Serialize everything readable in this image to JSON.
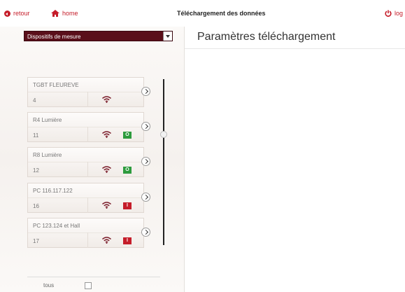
{
  "header": {
    "back_label": "retour",
    "home_label": "home",
    "title": "Téléchargement des données",
    "logout_label": "log"
  },
  "sidebar": {
    "dropdown_value": "Dispositifs de mesure",
    "devices": [
      {
        "name": "TGBT FLEUREVE",
        "number": "4",
        "badge": "",
        "badge_color": ""
      },
      {
        "name": "R4 Lumière",
        "number": "11",
        "badge": "O",
        "badge_color": "green"
      },
      {
        "name": "R8 Lumière",
        "number": "12",
        "badge": "O",
        "badge_color": "green"
      },
      {
        "name": "PC 116.117.122",
        "number": "16",
        "badge": "I",
        "badge_color": "red"
      },
      {
        "name": "PC 123.124 et Hall",
        "number": "17",
        "badge": "I",
        "badge_color": "red"
      }
    ],
    "all_label": "tous"
  },
  "main": {
    "title": "Paramètres téléchargement"
  },
  "colors": {
    "accent_red": "#c51d2a",
    "dropdown_bg": "#5a0f1a",
    "badge_green": "#2d9b3d"
  }
}
